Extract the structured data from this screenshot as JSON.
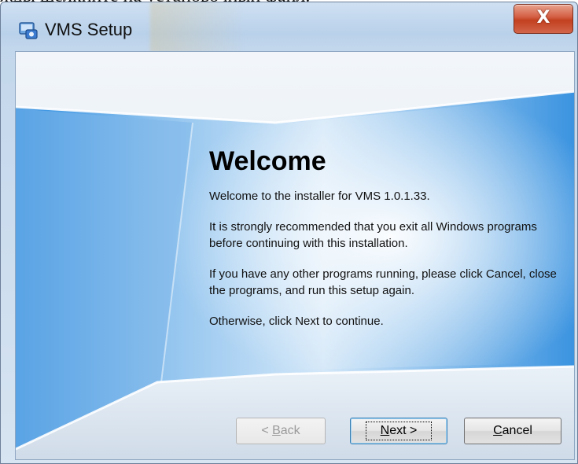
{
  "background_text": "жды щелкните на установочный файл.",
  "window": {
    "title": "VMS Setup",
    "close_label": "X"
  },
  "welcome": {
    "title": "Welcome",
    "paragraphs": [
      "Welcome to the installer for VMS 1.0.1.33.",
      "It is strongly recommended that you exit all Windows programs before continuing with this installation.",
      "If you have any other programs running, please click Cancel, close the programs, and run this setup again.",
      "Otherwise, click Next to continue."
    ]
  },
  "buttons": {
    "back": {
      "prefix": "< ",
      "mnemonic": "B",
      "rest": "ack",
      "enabled": false
    },
    "next": {
      "mnemonic": "N",
      "rest": "ext >",
      "enabled": true
    },
    "cancel": {
      "mnemonic": "C",
      "rest": "ancel",
      "enabled": true
    }
  },
  "colors": {
    "close_button": "#c9472a",
    "art_blue": "#2f8fe0",
    "art_light": "#eef4fa"
  },
  "icons": {
    "app": "installer-icon",
    "close": "close-icon"
  }
}
